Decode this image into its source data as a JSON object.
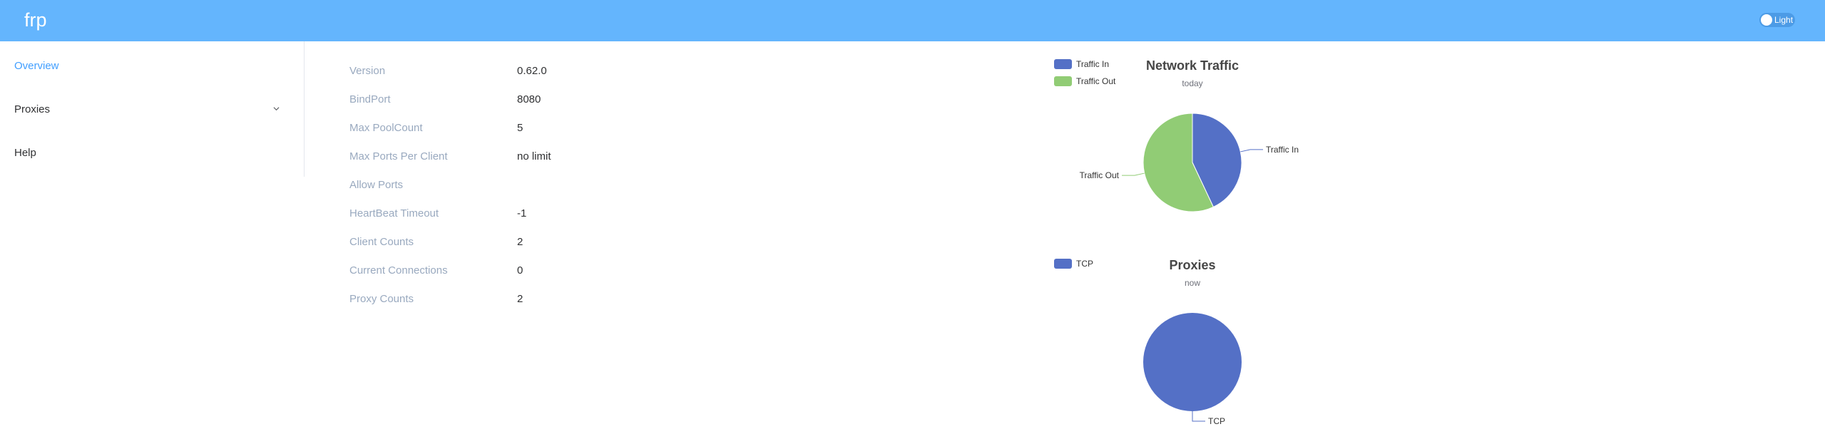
{
  "header": {
    "brand": "frp",
    "theme_toggle_label": "Light"
  },
  "sidebar": {
    "items": [
      {
        "label": "Overview",
        "active": true
      },
      {
        "label": "Proxies",
        "expandable": true,
        "icon": "chevron-down-icon"
      },
      {
        "label": "Help"
      }
    ]
  },
  "server_info": [
    {
      "label": "Version",
      "value": "0.62.0"
    },
    {
      "label": "BindPort",
      "value": "8080"
    },
    {
      "label": "Max PoolCount",
      "value": "5"
    },
    {
      "label": "Max Ports Per Client",
      "value": "no limit"
    },
    {
      "label": "Allow Ports",
      "value": ""
    },
    {
      "label": "HeartBeat Timeout",
      "value": "-1"
    },
    {
      "label": "Client Counts",
      "value": "2"
    },
    {
      "label": "Current Connections",
      "value": "0"
    },
    {
      "label": "Proxy Counts",
      "value": "2"
    }
  ],
  "colors": {
    "header": "#64b5fd",
    "active_menu": "#409eff",
    "label": "#99a9bf",
    "series_blue": "#5470c6",
    "series_green": "#91cc75"
  },
  "chart_data": [
    {
      "type": "pie",
      "title": "Network Traffic",
      "subtitle": "today",
      "legend_position": "top-left",
      "slices": [
        {
          "name": "Traffic In",
          "value": 0.43,
          "color": "#5470c6"
        },
        {
          "name": "Traffic Out",
          "value": 0.57,
          "color": "#91cc75"
        }
      ]
    },
    {
      "type": "pie",
      "title": "Proxies",
      "subtitle": "now",
      "legend_position": "top-left",
      "slices": [
        {
          "name": "TCP",
          "value": 2,
          "color": "#5470c6"
        }
      ]
    }
  ]
}
